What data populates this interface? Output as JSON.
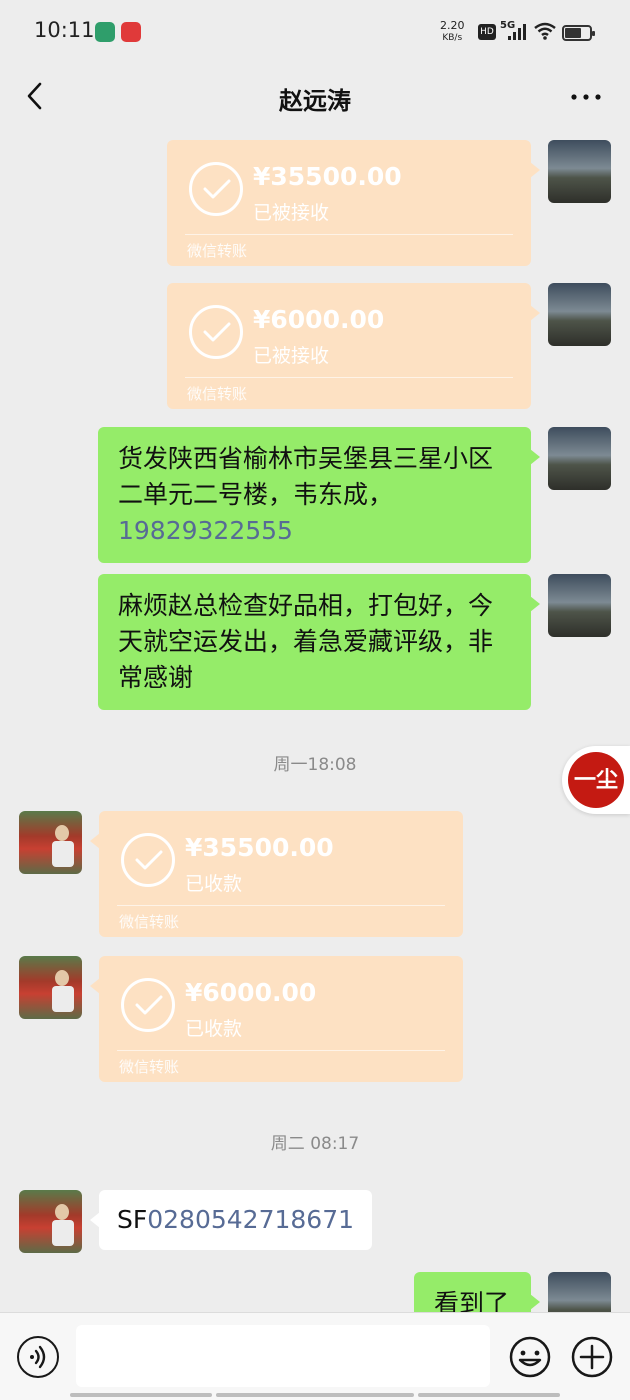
{
  "status_bar": {
    "time": "10:11",
    "net_speed": "2.20",
    "net_unit": "KB/s",
    "hd": "HD",
    "network": "5G"
  },
  "nav": {
    "title": "赵远涛"
  },
  "messages": {
    "t1": {
      "amount": "¥35500.00",
      "status": "已被接收",
      "footer": "微信转账"
    },
    "t2": {
      "amount": "¥6000.00",
      "status": "已被接收",
      "footer": "微信转账"
    },
    "m1": {
      "text": "货发陕西省榆林市吴堡县三星小区二单元二号楼，韦东成，",
      "phone": "19829322555"
    },
    "m2": {
      "text": "麻烦赵总检查好品相，打包好，今天就空运发出，着急爱藏评级，非常感谢"
    },
    "ts1": "周一18:08",
    "t3": {
      "amount": "¥35500.00",
      "status": "已收款",
      "footer": "微信转账"
    },
    "t4": {
      "amount": "¥6000.00",
      "status": "已收款",
      "footer": "微信转账"
    },
    "ts2": "周二 08:17",
    "m3": {
      "prefix": "SF",
      "number": "0280542718671"
    },
    "m4": {
      "text": "看到了"
    }
  },
  "floating_badge": {
    "label": "一尘"
  },
  "input": {
    "placeholder": ""
  },
  "colors": {
    "bubble_green": "#95ec69",
    "transfer": "#fde1c3",
    "link": "#576b95",
    "background": "#ededed"
  },
  "icons": {
    "back": "chevron-left-icon",
    "more": "more-dots-icon",
    "voice": "voice-icon",
    "emoji": "emoji-icon",
    "plus": "plus-icon",
    "check": "check-icon"
  }
}
